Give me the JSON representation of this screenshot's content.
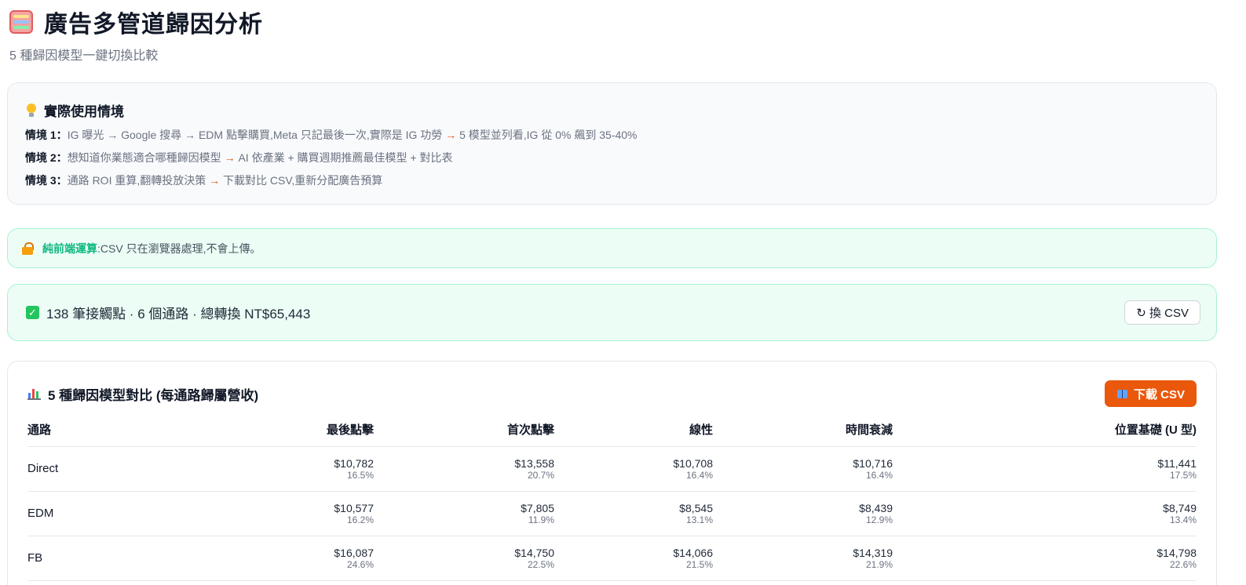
{
  "header": {
    "icon": "abacus-icon",
    "title": "廣告多管道歸因分析",
    "subtitle": "5 種歸因模型一鍵切換比較"
  },
  "usage": {
    "icon": "lightbulb-icon",
    "heading": "實際使用情境",
    "scenarios": [
      {
        "label": "情境 1：",
        "before": "IG 曝光 → Google 搜尋 → EDM 點擊購買,Meta 只記最後一次,實際是 IG 功勞 ",
        "arrow": "→",
        "after": " 5 模型並列看,IG 從 0% 飆到 35-40%"
      },
      {
        "label": "情境 2：",
        "before": "想知道你業態適合哪種歸因模型 ",
        "arrow": "→",
        "after": " AI 依產業 + 購買週期推薦最佳模型 + 對比表"
      },
      {
        "label": "情境 3：",
        "before": "通路 ROI 重算,翻轉投放決策 ",
        "arrow": "→",
        "after": " 下載對比 CSV,重新分配廣告預算"
      }
    ]
  },
  "notice": {
    "icon": "lock-icon",
    "highlight": "純前端運算",
    "text": ":CSV 只在瀏覽器處理,不會上傳。"
  },
  "status": {
    "icon": "check-icon",
    "text": "138 筆接觸點 · 6 個通路 · 總轉換 NT$65,443",
    "change_button": "↻ 換 CSV"
  },
  "comparison": {
    "icon": "bar-chart-icon",
    "title": "5 種歸因模型對比 (每通路歸屬營收)",
    "download_button": "下載 CSV",
    "download_icon": "book-icon",
    "columns": [
      "通路",
      "最後點擊",
      "首次點擊",
      "線性",
      "時間衰減",
      "位置基礎 (U 型)"
    ],
    "rows": [
      {
        "channel": "Direct",
        "cells": [
          {
            "amount": "$10,782",
            "pct": "16.5%"
          },
          {
            "amount": "$13,558",
            "pct": "20.7%"
          },
          {
            "amount": "$10,708",
            "pct": "16.4%"
          },
          {
            "amount": "$10,716",
            "pct": "16.4%"
          },
          {
            "amount": "$11,441",
            "pct": "17.5%"
          }
        ]
      },
      {
        "channel": "EDM",
        "cells": [
          {
            "amount": "$10,577",
            "pct": "16.2%"
          },
          {
            "amount": "$7,805",
            "pct": "11.9%"
          },
          {
            "amount": "$8,545",
            "pct": "13.1%"
          },
          {
            "amount": "$8,439",
            "pct": "12.9%"
          },
          {
            "amount": "$8,749",
            "pct": "13.4%"
          }
        ]
      },
      {
        "channel": "FB",
        "cells": [
          {
            "amount": "$16,087",
            "pct": "24.6%"
          },
          {
            "amount": "$14,750",
            "pct": "22.5%"
          },
          {
            "amount": "$14,066",
            "pct": "21.5%"
          },
          {
            "amount": "$14,319",
            "pct": "21.9%"
          },
          {
            "amount": "$14,798",
            "pct": "22.6%"
          }
        ]
      }
    ]
  },
  "colors": {
    "accent": "#ea580c",
    "success_bg": "#ecfdf5",
    "success_border": "#a7f3d0",
    "highlight_green": "#10b981"
  }
}
